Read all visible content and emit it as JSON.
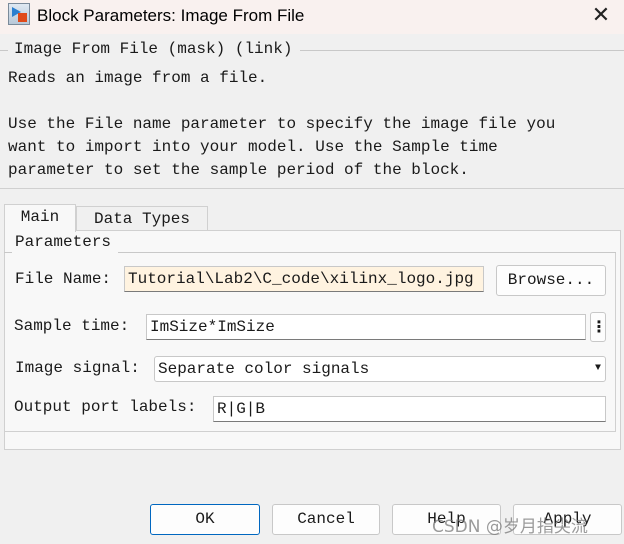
{
  "window": {
    "title": "Block Parameters: Image From File",
    "close_icon": "close-icon",
    "app_icon": "simulink-block-icon"
  },
  "description": {
    "group_title": "Image From File (mask) (link)",
    "lines": [
      "Reads an image from a file.",
      "",
      "Use the File name parameter to specify the image file you",
      "want to import into your model. Use the Sample time",
      "parameter to set the sample period of the block."
    ]
  },
  "tabs": [
    {
      "label": "Main",
      "active": true
    },
    {
      "label": "Data Types",
      "active": false
    }
  ],
  "parameters": {
    "group_title": "Parameters",
    "file_name": {
      "label": "File Name:",
      "value": "Tutorial\\Lab2\\C_code\\xilinx_logo.jpg",
      "visible_value": "Tutorial\\Lab2\\C_code\\xilinx_logo.jpg",
      "browse_label": "Browse...",
      "bg": "#fff3e0"
    },
    "sample_time": {
      "label": "Sample time:",
      "value": "ImSize*ImSize",
      "menu_icon": "vertical-ellipsis-icon"
    },
    "image_signal": {
      "label": "Image signal:",
      "value": "Separate color signals"
    },
    "output_port_labels": {
      "label": "Output port labels:",
      "value": "R|G|B"
    }
  },
  "buttons": {
    "ok": "OK",
    "cancel": "Cancel",
    "help": "Help",
    "apply": "Apply"
  },
  "watermark": "CSDN @岁月指尖流",
  "colors": {
    "accent": "#0067c0",
    "titlebar": "#f9f1ef"
  }
}
